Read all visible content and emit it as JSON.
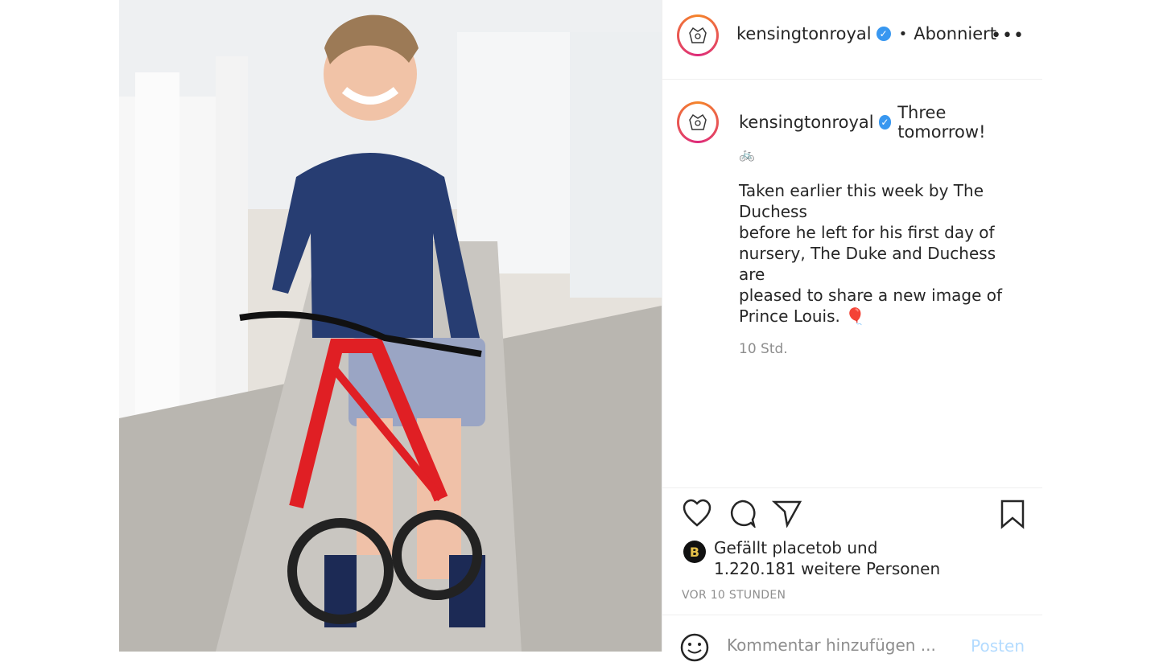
{
  "post": {
    "username": "kensingtonroyal",
    "follow_status": "Abonniert",
    "more_icon": "more-horizontal-icon",
    "caption": {
      "headline": "Three tomorrow!",
      "emoji": "🚲",
      "body": "Taken earlier this week by The Duchess\nbefore he left for his first day of\nnursery, The Duke and Duchess are\npleased to share a new image of\nPrince Louis. 🎈",
      "relative_time": "10 Std."
    },
    "likes": {
      "prefix": "Gefällt",
      "liker": "placetob",
      "middle": "und",
      "count_text": "1.220.181 weitere Personen",
      "liker_avatar_letter": "B"
    },
    "posted_time": "VOR 10 STUNDEN",
    "comment": {
      "placeholder": "Kommentar hinzufügen ...",
      "post_label": "Posten"
    }
  },
  "colors": {
    "verified": "#3897f0",
    "ring_start": "#f58529",
    "ring_end": "#dd2a7b",
    "muted": "#8e8e8e",
    "post_button": "#b3dbff"
  }
}
